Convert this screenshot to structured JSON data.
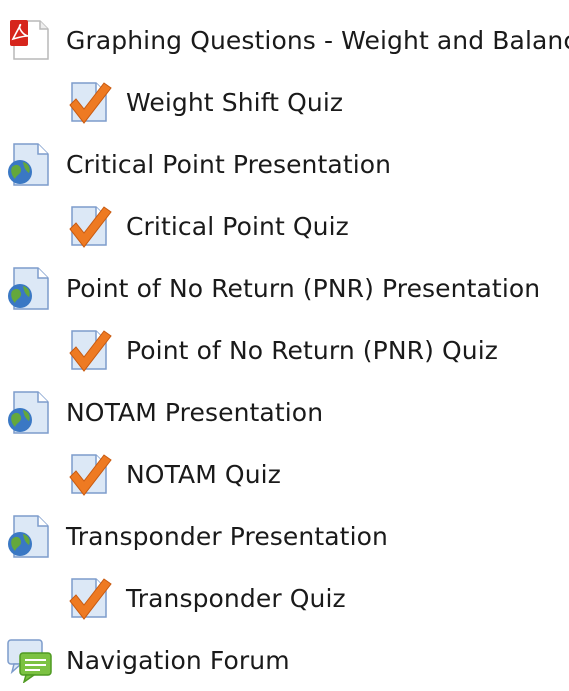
{
  "activities": [
    {
      "label": "Graphing Questions - Weight and Balance",
      "icon": "pdf-icon",
      "indent": 0
    },
    {
      "label": "Weight Shift Quiz",
      "icon": "quiz-icon",
      "indent": 1
    },
    {
      "label": "Critical Point Presentation",
      "icon": "url-globe-icon",
      "indent": 0
    },
    {
      "label": "Critical Point Quiz",
      "icon": "quiz-icon",
      "indent": 1
    },
    {
      "label": "Point of No Return (PNR) Presentation",
      "icon": "url-globe-icon",
      "indent": 0
    },
    {
      "label": "Point of No Return (PNR) Quiz",
      "icon": "quiz-icon",
      "indent": 1
    },
    {
      "label": "NOTAM Presentation",
      "icon": "url-globe-icon",
      "indent": 0
    },
    {
      "label": "NOTAM Quiz",
      "icon": "quiz-icon",
      "indent": 1
    },
    {
      "label": "Transponder Presentation",
      "icon": "url-globe-icon",
      "indent": 0
    },
    {
      "label": "Transponder Quiz",
      "icon": "quiz-icon",
      "indent": 1
    },
    {
      "label": "Navigation Forum",
      "icon": "forum-icon",
      "indent": 0
    }
  ],
  "colors": {
    "text": "#1a1a1a",
    "pdf_red": "#d6251c",
    "page_blue": "#dce8f6",
    "page_border": "#7d9ccc",
    "check_orange": "#ee7a22",
    "globe_blue": "#3a78c4",
    "globe_green": "#64a83c",
    "forum_green": "#7cc242"
  }
}
